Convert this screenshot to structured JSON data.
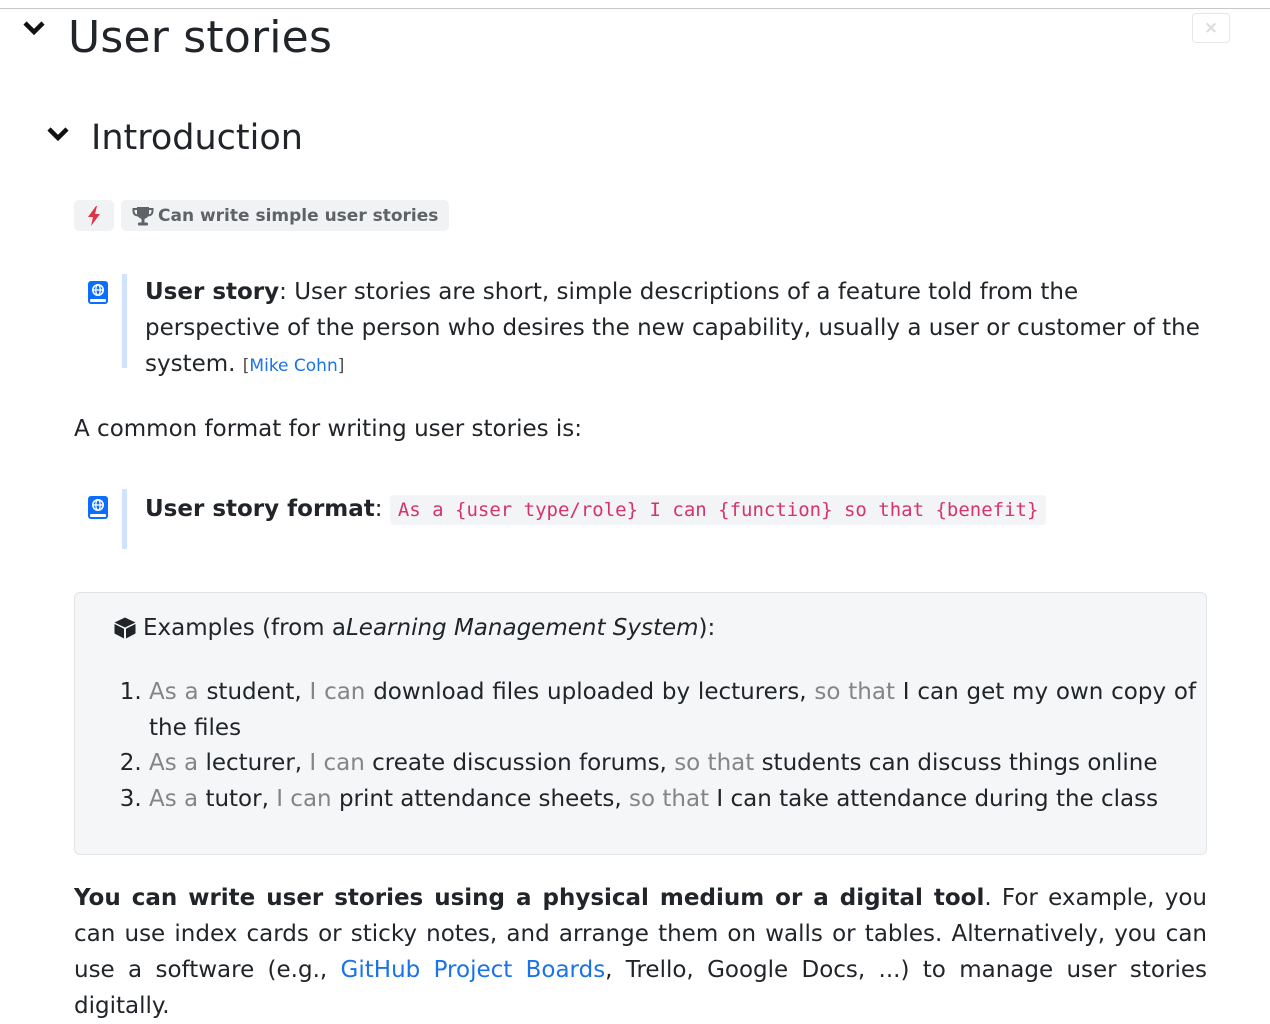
{
  "page": {
    "title": "User stories",
    "close_label": "×"
  },
  "section": {
    "title": "Introduction"
  },
  "badges": {
    "outcome_label": "Can write simple user stories"
  },
  "definition_user_story": {
    "term": "User story",
    "text": ": User stories are short, simple descriptions of a feature told from the perspective of the person who desires the new capability, usually a user or customer of the system.",
    "cite_open": "[",
    "cite_link": "Mike Cohn",
    "cite_close": "]"
  },
  "format_intro": "A common format for writing user stories is:",
  "definition_format": {
    "term": "User story format",
    "separator": ":",
    "code": "As a {user type/role} I can {function} so that {benefit}"
  },
  "examples": {
    "title_prefix": "Examples (from a ",
    "title_italic": "Learning Management System",
    "title_suffix": "):",
    "items": [
      {
        "as_a": "As a",
        "role": "student,",
        "i_can": "I can",
        "function": "download files uploaded by lecturers,",
        "so_that": "so that",
        "benefit": "I can get my own copy of the files"
      },
      {
        "as_a": "As a",
        "role": "lecturer,",
        "i_can": "I can",
        "function": "create discussion forums,",
        "so_that": "so that",
        "benefit": "students can discuss things online"
      },
      {
        "as_a": "As a",
        "role": "tutor,",
        "i_can": "I can",
        "function": "print attendance sheets,",
        "so_that": "so that",
        "benefit": "I can take attendance during the class"
      }
    ]
  },
  "closing": {
    "bold": "You can write user stories using a physical medium or a digital tool",
    "text1": ". For example, you can use index cards or sticky notes, and arrange them on walls or tables. Alternatively, you can use a software (e.g., ",
    "link": "GitHub Project Boards",
    "text2": ", Trello, Google Docs, ...) to manage user stories digitally."
  },
  "icons": {
    "collapse_page": "chevron-down-icon",
    "collapse_section": "chevron-down-icon",
    "flash": "lightning-bolt-icon",
    "trophy": "trophy-icon",
    "definition": "book-globe-icon",
    "examples": "box-icon",
    "close": "close-icon"
  },
  "colors": {
    "link": "#1a73e8",
    "code": "#d6336c",
    "muted": "#858585",
    "flash": "#dc3545",
    "definition_bar": "#cfe2ff",
    "definition_icon": "#0d6efd"
  }
}
